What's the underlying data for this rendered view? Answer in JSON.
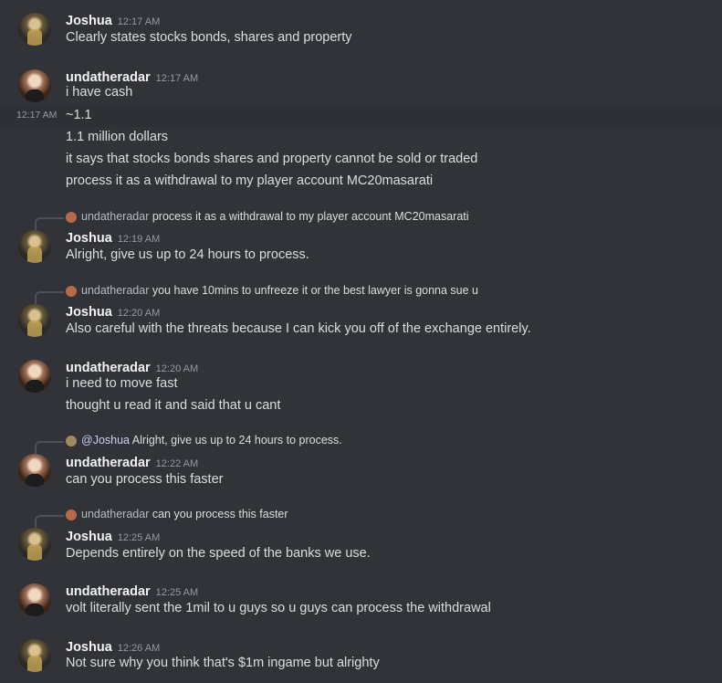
{
  "messages": {
    "m1": {
      "author": "Joshua",
      "time": "12:17 AM",
      "lines": [
        "Clearly states stocks bonds, shares and property"
      ]
    },
    "m2": {
      "author": "undatheradar",
      "time": "12:17 AM",
      "lines": [
        "i have cash"
      ]
    },
    "m2b": {
      "side_time": "12:17 AM",
      "lines": [
        "~1.1",
        "1.1 million dollars",
        "it says that stocks bonds shares and property cannot be sold or traded",
        "process it as a withdrawal to my player account MC20masarati"
      ]
    },
    "m3": {
      "reply_name": "undatheradar",
      "reply_text": "process it as a withdrawal to my player account MC20masarati",
      "author": "Joshua",
      "time": "12:19 AM",
      "lines": [
        "Alright, give us up to 24 hours to process."
      ]
    },
    "m4": {
      "reply_name": "undatheradar",
      "reply_text": "you have 10mins to unfreeze it or the best lawyer is gonna sue u",
      "author": "Joshua",
      "time": "12:20 AM",
      "lines": [
        "Also careful with the threats because I can kick you off of the exchange entirely."
      ]
    },
    "m5": {
      "author": "undatheradar",
      "time": "12:20 AM",
      "lines": [
        "i need to move fast",
        "thought u read it and said that u cant"
      ]
    },
    "m6": {
      "reply_name": "@Joshua",
      "reply_text": "Alright, give us up to 24 hours to process.",
      "author": "undatheradar",
      "time": "12:22 AM",
      "lines": [
        "can you process this faster"
      ]
    },
    "m7": {
      "reply_name": "undatheradar",
      "reply_text": "can you process this faster",
      "author": "Joshua",
      "time": "12:25 AM",
      "lines": [
        "Depends entirely on the speed of the banks we use."
      ]
    },
    "m8": {
      "author": "undatheradar",
      "time": "12:25 AM",
      "lines": [
        "volt literally sent the 1mil to u guys so u guys can process the withdrawal"
      ]
    },
    "m9": {
      "author": "Joshua",
      "time": "12:26 AM",
      "lines": [
        "Not sure why you think that's $1m ingame but alrighty"
      ]
    }
  }
}
